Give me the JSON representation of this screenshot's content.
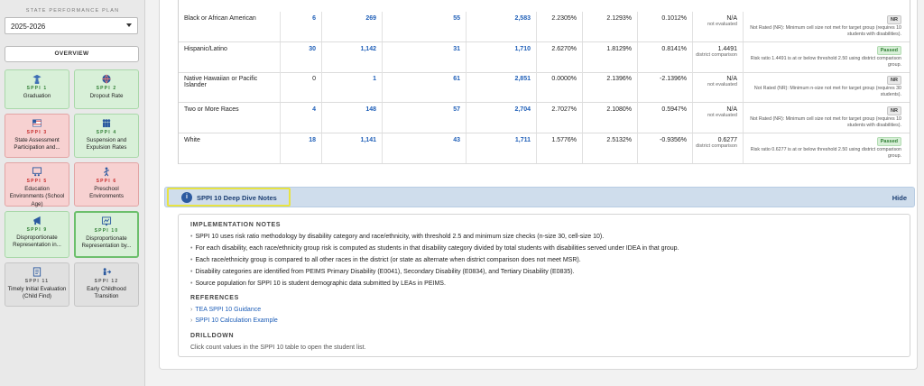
{
  "sidebar": {
    "plan_label": "STATE PERFORMANCE PLAN",
    "year": "2025-2026",
    "overview_label": "OVERVIEW",
    "tiles": [
      {
        "code": "SPPI 1",
        "name": "Graduation",
        "status": "green",
        "icon": "graduate-icon"
      },
      {
        "code": "SPPI 2",
        "name": "Dropout Rate",
        "status": "green",
        "icon": "globe-icon"
      },
      {
        "code": "SPPI 3",
        "name": "State Assessment Participation and...",
        "status": "red",
        "icon": "flag-icon"
      },
      {
        "code": "SPPI 4",
        "name": "Suspension and Expulsion Rates",
        "status": "green",
        "icon": "people-icon"
      },
      {
        "code": "SPPI 5",
        "name": "Education Environments (School Age)",
        "status": "red",
        "icon": "classroom-icon"
      },
      {
        "code": "SPPI 6",
        "name": "Preschool Environments",
        "status": "red",
        "icon": "child-icon"
      },
      {
        "code": "SPPI 9",
        "name": "Disproportionate Representation in...",
        "status": "green",
        "icon": "megaphone-icon"
      },
      {
        "code": "SPPI 10",
        "name": "Disproportionate Representation by...",
        "status": "green",
        "icon": "chart-board-icon",
        "active": true
      },
      {
        "code": "SPPI 11",
        "name": "Timely Initial Evaluation (Child Find)",
        "status": "gray",
        "icon": "document-icon"
      },
      {
        "code": "SPPI 12",
        "name": "Early Childhood Transition",
        "status": "gray",
        "icon": "transition-icon"
      }
    ]
  },
  "table": {
    "rows": [
      {
        "race": "Black or African American",
        "a": "6",
        "b": "269",
        "c": "55",
        "d": "2,583",
        "r1": "2.2305%",
        "r2": "2.1293%",
        "diff": "0.1012%",
        "cmp_value": "N/A",
        "cmp_note": "not evaluated",
        "badge": "NR",
        "badge_type": "nr",
        "note": "Not Rated (NR): Minimum cell size not met for target group (requires 10 students with disabilities)."
      },
      {
        "race": "Hispanic/Latino",
        "a": "30",
        "b": "1,142",
        "c": "31",
        "d": "1,710",
        "r1": "2.6270%",
        "r2": "1.8129%",
        "diff": "0.8141%",
        "cmp_value": "1.4491",
        "cmp_note": "district comparison",
        "badge": "Passed",
        "badge_type": "passed",
        "note": "Risk ratio 1.4491 is at or below threshold 2.50 using district comparison group."
      },
      {
        "race": "Native Hawaiian or Pacific Islander",
        "a": "0",
        "b": "1",
        "c": "61",
        "d": "2,851",
        "r1": "0.0000%",
        "r2": "2.1396%",
        "diff": "-2.1396%",
        "cmp_value": "N/A",
        "cmp_note": "not evaluated",
        "badge": "NR",
        "badge_type": "nr",
        "note": "Not Rated (NR): Minimum n-size not met for target group (requires 30 students)."
      },
      {
        "race": "Two or More Races",
        "a": "4",
        "b": "148",
        "c": "57",
        "d": "2,704",
        "r1": "2.7027%",
        "r2": "2.1080%",
        "diff": "0.5947%",
        "cmp_value": "N/A",
        "cmp_note": "not evaluated",
        "badge": "NR",
        "badge_type": "nr",
        "note": "Not Rated (NR): Minimum cell size not met for target group (requires 10 students with disabilities)."
      },
      {
        "race": "White",
        "a": "18",
        "b": "1,141",
        "c": "43",
        "d": "1,711",
        "r1": "1.5776%",
        "r2": "2.5132%",
        "diff": "-0.9356%",
        "cmp_value": "0.6277",
        "cmp_note": "district comparison",
        "badge": "Passed",
        "badge_type": "passed",
        "note": "Risk ratio 0.6277 is at or below threshold 2.50 using district comparison group."
      }
    ]
  },
  "deep_dive": {
    "title": "SPPI 10 Deep Dive Notes",
    "hide_label": "Hide",
    "implementation_heading": "IMPLEMENTATION NOTES",
    "bullets": [
      "SPPI 10 uses risk ratio methodology by disability category and race/ethnicity, with threshold 2.5 and minimum size checks (n-size 30, cell-size 10).",
      "For each disability, each race/ethnicity group risk is computed as students in that disability category divided by total students with disabilities served under IDEA in that group.",
      "Each race/ethnicity group is compared to all other races in the district (or state as alternate when district comparison does not meet MSR).",
      "Disability categories are identified from PEIMS Primary Disability (E0041), Secondary Disability (E0834), and Tertiary Disability (E0835).",
      "Source population for SPPI 10 is student demographic data submitted by LEAs in PEIMS."
    ],
    "references_heading": "REFERENCES",
    "references": [
      "TEA SPPI 10 Guidance",
      "SPPI 10 Calculation Example"
    ],
    "drilldown_heading": "DRILLDOWN",
    "drilldown_text": "Click count values in the SPPI 10 table to open the student list."
  }
}
